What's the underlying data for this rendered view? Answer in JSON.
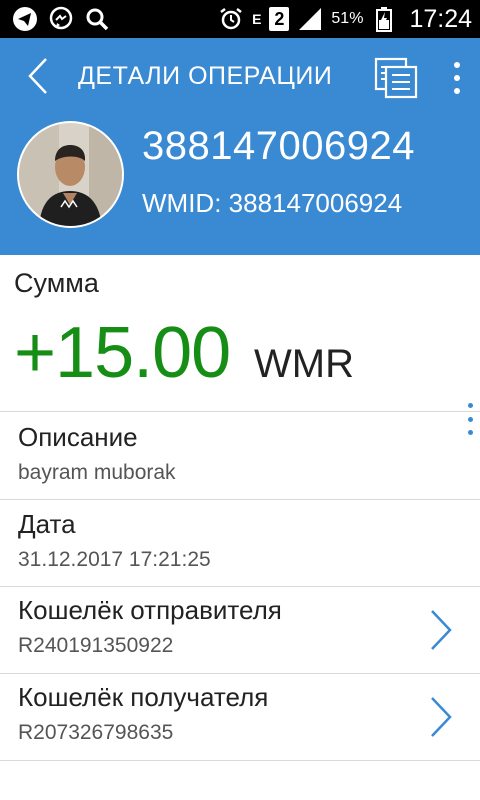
{
  "status_bar": {
    "icons": [
      "telegram-icon",
      "messenger-icon",
      "search-icon",
      "alarm-icon",
      "network-e-icon",
      "sim-2-icon",
      "signal-icon",
      "battery-icon"
    ],
    "network_type": "E",
    "sim_slot": "2",
    "battery": "51%",
    "time": "17:24"
  },
  "toolbar": {
    "title": "ДЕТАЛИ ОПЕРАЦИИ"
  },
  "account": {
    "id": "388147006924",
    "wmid": "WMID: 388147006924"
  },
  "amount": {
    "label": "Сумма",
    "value": "+15.00",
    "currency": "WMR",
    "color": "#168e16"
  },
  "details": [
    {
      "label": "Описание",
      "value": "bayram muborak"
    },
    {
      "label": "Дата",
      "value": "31.12.2017 17:21:25"
    },
    {
      "label": "Кошелёк отправителя",
      "value": "R240191350922"
    },
    {
      "label": "Кошелёк получателя",
      "value": "R207326798635"
    }
  ],
  "colors": {
    "header": "#3a8ad3",
    "accent": "#3a8ad3",
    "amount": "#168e16"
  }
}
